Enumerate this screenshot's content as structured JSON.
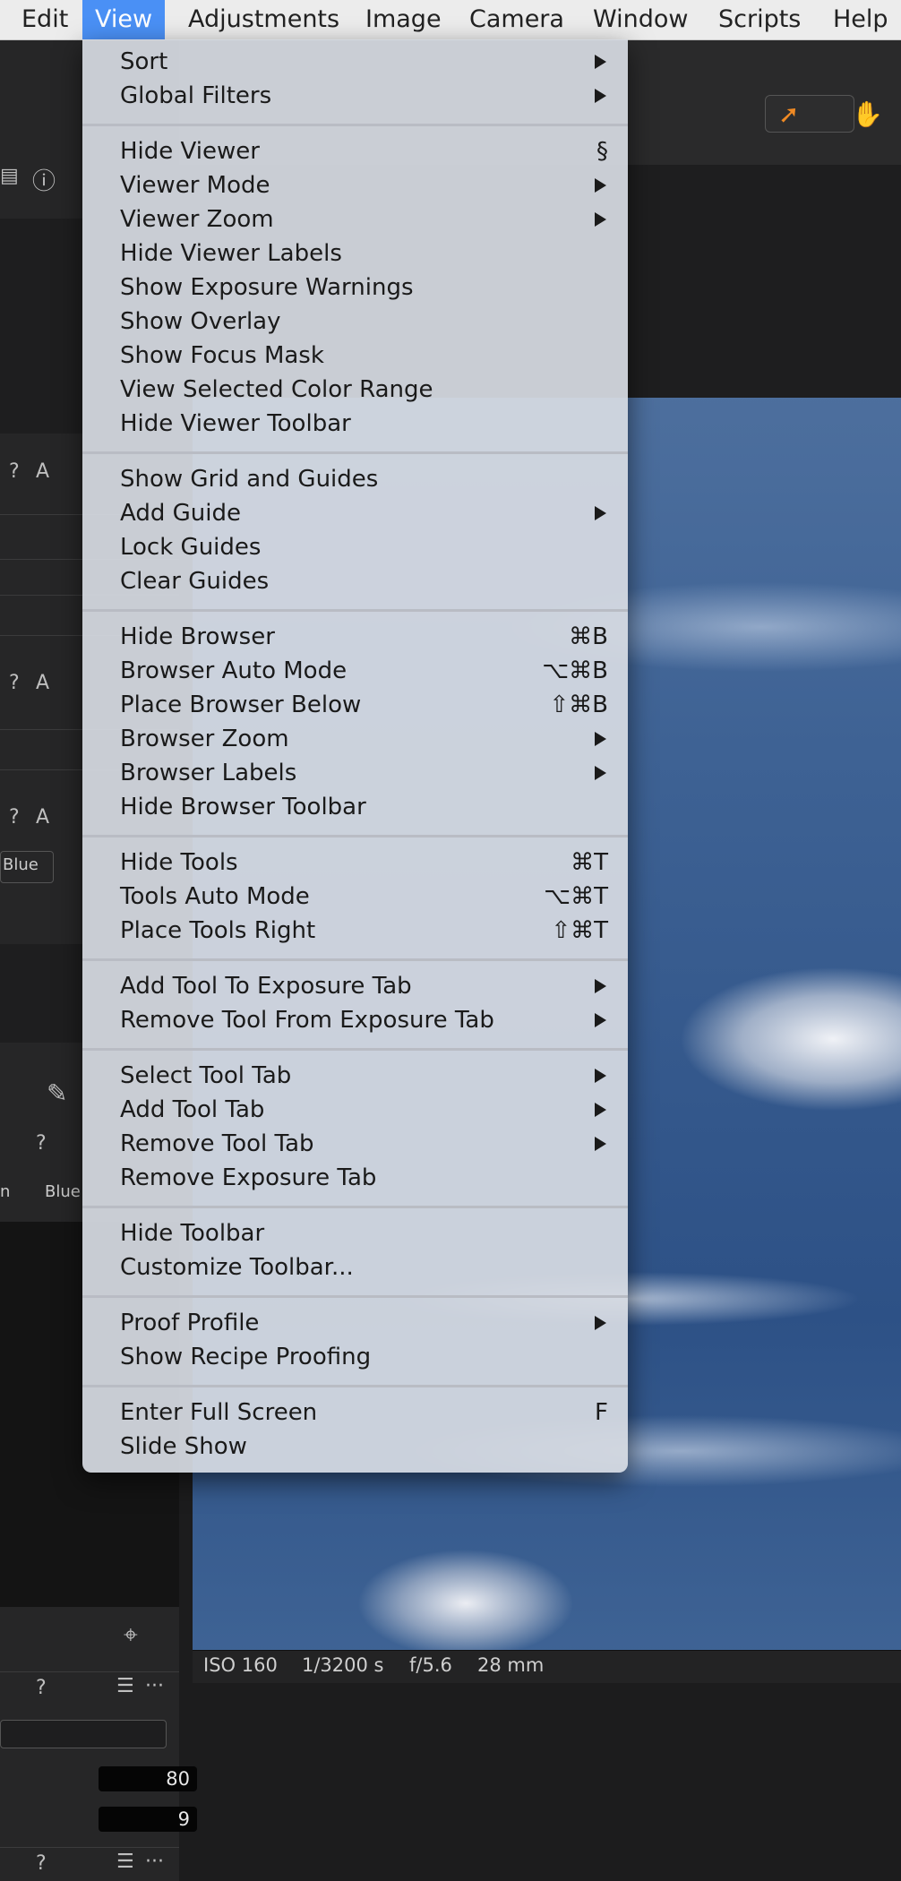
{
  "menubar": {
    "items": [
      {
        "label": "Edit"
      },
      {
        "label": "View"
      },
      {
        "label": "Adjustments"
      },
      {
        "label": "Image"
      },
      {
        "label": "Camera"
      },
      {
        "label": "Window"
      },
      {
        "label": "Scripts"
      },
      {
        "label": "Help"
      }
    ],
    "active": "View"
  },
  "view_menu": {
    "items": [
      {
        "label": "Sort",
        "submenu": true
      },
      {
        "label": "Global Filters",
        "submenu": true
      },
      {
        "label": "Hide Viewer",
        "shortcut": "§"
      },
      {
        "label": "Viewer Mode",
        "submenu": true
      },
      {
        "label": "Viewer Zoom",
        "submenu": true
      },
      {
        "label": "Hide Viewer Labels"
      },
      {
        "label": "Show Exposure Warnings"
      },
      {
        "label": "Show Overlay"
      },
      {
        "label": "Show Focus Mask"
      },
      {
        "label": "View Selected Color Range"
      },
      {
        "label": "Hide Viewer Toolbar"
      },
      {
        "label": "Show Grid and Guides"
      },
      {
        "label": "Add Guide",
        "submenu": true
      },
      {
        "label": "Lock Guides"
      },
      {
        "label": "Clear Guides"
      },
      {
        "label": "Hide Browser",
        "shortcut": "⌘B"
      },
      {
        "label": "Browser Auto Mode",
        "shortcut": "⌥⌘B"
      },
      {
        "label": "Place Browser Below",
        "shortcut": "⇧⌘B"
      },
      {
        "label": "Browser Zoom",
        "submenu": true
      },
      {
        "label": "Browser Labels",
        "submenu": true
      },
      {
        "label": "Hide Browser Toolbar"
      },
      {
        "label": "Hide Tools",
        "shortcut": "⌘T"
      },
      {
        "label": "Tools Auto Mode",
        "shortcut": "⌥⌘T"
      },
      {
        "label": "Place Tools Right",
        "shortcut": "⇧⌘T"
      },
      {
        "label": "Add Tool To Exposure Tab",
        "submenu": true
      },
      {
        "label": "Remove Tool From Exposure Tab",
        "submenu": true
      },
      {
        "label": "Select Tool Tab",
        "submenu": true
      },
      {
        "label": "Add Tool Tab",
        "submenu": true
      },
      {
        "label": "Remove Tool Tab",
        "submenu": true
      },
      {
        "label": "Remove Exposure Tab"
      },
      {
        "label": "Hide Toolbar"
      },
      {
        "label": "Customize Toolbar..."
      },
      {
        "label": "Proof Profile",
        "submenu": true
      },
      {
        "label": "Show Recipe Proofing"
      },
      {
        "label": "Enter Full Screen",
        "shortcut": "F"
      },
      {
        "label": "Slide Show"
      }
    ]
  },
  "background": {
    "left_panel": {
      "tool_glyph_a": "A",
      "tool_glyph_q": "?",
      "channel_label_blue": "Blue",
      "channel_label_n": "n",
      "channel_label_blue_2": "Blue",
      "value_1": "80",
      "value_2": "9",
      "dots": "···",
      "list": "☰"
    },
    "status_bar": {
      "iso": "ISO 160",
      "shutter": "1/3200 s",
      "aperture": "f/5.6",
      "focal": "28 mm"
    }
  },
  "colors": {
    "menubar_active": "#4a90f5",
    "menu_bg": "#d6dae2"
  }
}
